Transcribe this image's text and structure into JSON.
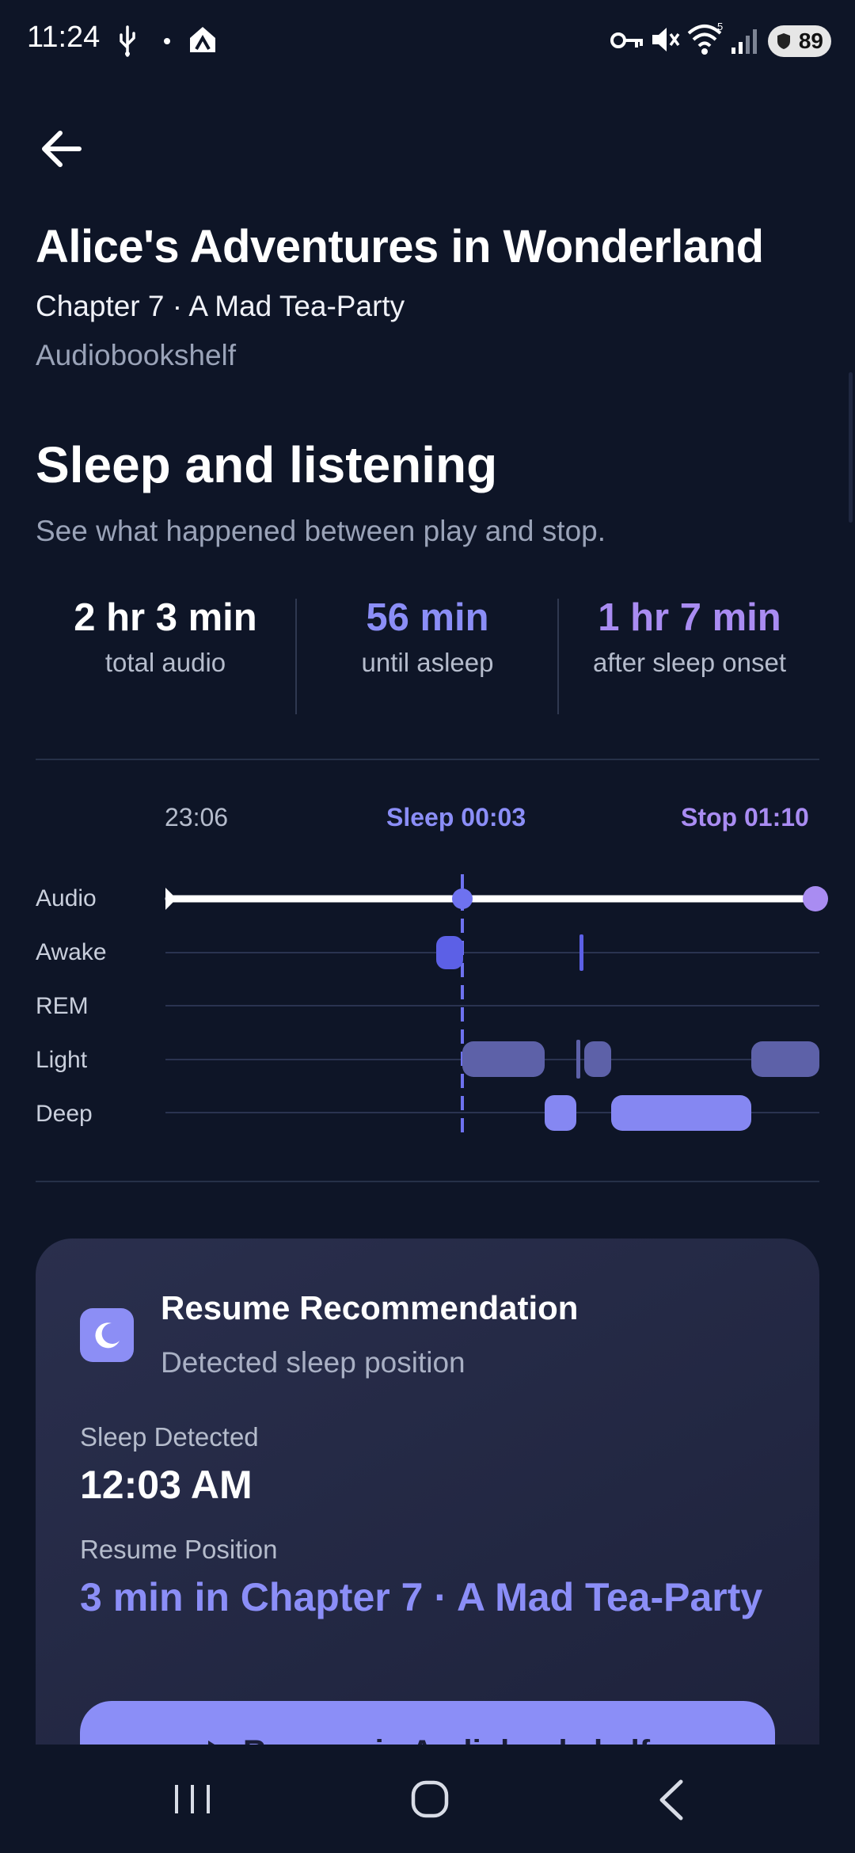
{
  "status_bar": {
    "time": "11:24",
    "battery": "89",
    "wifi_badge": "5"
  },
  "header": {
    "book_title": "Alice's Adventures in Wonderland",
    "chapter": "Chapter 7 · A Mad Tea-Party",
    "source": "Audiobookshelf"
  },
  "section": {
    "title": "Sleep and listening",
    "subtitle": "See what happened between play and stop."
  },
  "stats": [
    {
      "value": "2 hr 3 min",
      "label": "total audio",
      "color": "#ffffff"
    },
    {
      "value": "56 min",
      "label": "until asleep",
      "color": "#8b8ef7"
    },
    {
      "value": "1 hr 7 min",
      "label": "after sleep onset",
      "color": "#a98cf2"
    }
  ],
  "timeline": {
    "start_label": "23:06",
    "sleep_label": "Sleep 00:03",
    "stop_label": "Stop 01:10",
    "rows": [
      "Audio",
      "Awake",
      "REM",
      "Light",
      "Deep"
    ],
    "colors": {
      "audio": "#ffffff",
      "sleep_marker": "#6e72f0",
      "awake": "#5c60e6",
      "light": "#5d61a8",
      "deep": "#8587f2",
      "stop": "#a98cf2"
    }
  },
  "recommendation": {
    "title": "Resume Recommendation",
    "subtitle": "Detected sleep position",
    "sleep_detected_label": "Sleep Detected",
    "sleep_detected_value": "12:03 AM",
    "resume_position_label": "Resume Position",
    "resume_position_value": "3 min in Chapter 7 · A Mad Tea-Party",
    "button_label": "Resume in Audiobookshelf"
  },
  "icons": {
    "back": "arrow-left-icon",
    "moon": "moon-icon",
    "play": "play-icon"
  }
}
